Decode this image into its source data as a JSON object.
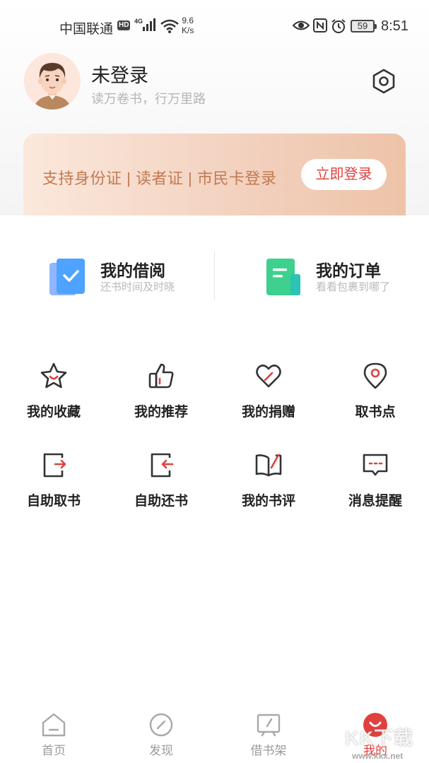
{
  "status_bar": {
    "carrier": "中国联通",
    "hd_badge": "HD",
    "network": "4G",
    "speed_value": "9.6",
    "speed_unit": "K/s",
    "battery": "59",
    "time": "8:51",
    "icons": [
      "signal-icon",
      "wifi-icon",
      "eye-icon",
      "nfc-icon",
      "alarm-icon",
      "battery-icon"
    ]
  },
  "profile": {
    "name": "未登录",
    "slogan": "读万卷书，行万里路",
    "avatar_icon": "avatar-icon",
    "settings_icon": "settings-icon"
  },
  "login_banner": {
    "text": "支持身份证 | 读者证 | 市民卡登录",
    "button": "立即登录"
  },
  "quick_actions": [
    {
      "title": "我的借阅",
      "subtitle": "还书时间及时晓",
      "icon": "borrow-book-icon"
    },
    {
      "title": "我的订单",
      "subtitle": "看看包裹到哪了",
      "icon": "order-document-icon"
    }
  ],
  "grid": [
    {
      "label": "我的收藏",
      "icon": "star-icon"
    },
    {
      "label": "我的推荐",
      "icon": "thumbs-up-icon"
    },
    {
      "label": "我的捐赠",
      "icon": "heart-icon"
    },
    {
      "label": "取书点",
      "icon": "location-pin-icon"
    },
    {
      "label": "自助取书",
      "icon": "self-pickup-icon"
    },
    {
      "label": "自助还书",
      "icon": "self-return-icon"
    },
    {
      "label": "我的书评",
      "icon": "book-review-icon"
    },
    {
      "label": "消息提醒",
      "icon": "message-icon"
    }
  ],
  "bottom_nav": [
    {
      "label": "首页",
      "icon": "home-icon",
      "active": false
    },
    {
      "label": "发现",
      "icon": "compass-icon",
      "active": false
    },
    {
      "label": "借书架",
      "icon": "bookshelf-icon",
      "active": false
    },
    {
      "label": "我的",
      "icon": "profile-icon",
      "active": true
    }
  ],
  "watermark": {
    "text": "KK下载",
    "url": "www.kkx.net"
  },
  "colors": {
    "accent": "#e0413f",
    "banner_text": "#c27a52",
    "icon_stroke": "#333333",
    "borrow_icon": "#4da3ff",
    "order_icon": "#3ed08e"
  }
}
